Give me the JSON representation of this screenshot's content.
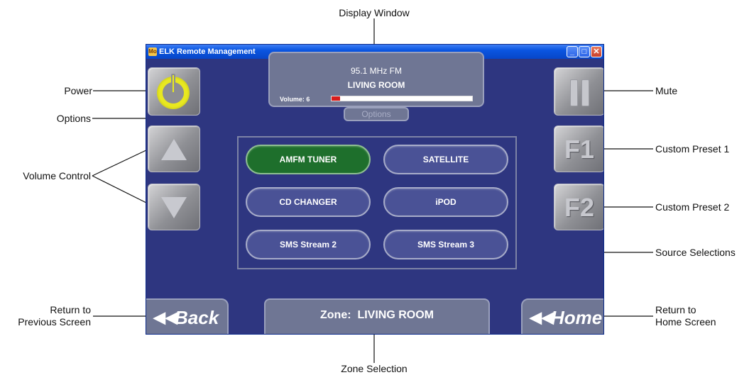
{
  "window": {
    "title": "ELK Remote Management",
    "app_icon": "Mo"
  },
  "display": {
    "frequency": "95.1 MHz FM",
    "room": "LIVING ROOM",
    "volume_label": "Volume: 6",
    "volume_fraction": 0.06
  },
  "options_label": "Options",
  "sources": [
    "AMFM TUNER",
    "SATELLITE",
    "CD CHANGER",
    "iPOD",
    "SMS Stream 2",
    "SMS Stream 3"
  ],
  "active_source": "AMFM TUNER",
  "presets": {
    "f1": "F1",
    "f2": "F2"
  },
  "nav": {
    "back": "Back",
    "home": "Home"
  },
  "zone_label": "Zone:  LIVING ROOM",
  "callouts": {
    "display_window": "Display Window",
    "power": "Power",
    "options": "Options",
    "volume_control": "Volume Control",
    "mute": "Mute",
    "custom_preset_1": "Custom Preset 1",
    "custom_preset_2": "Custom Preset 2",
    "source_selections": "Source Selections",
    "return_previous_1": "Return to",
    "return_previous_2": "Previous Screen",
    "return_home_1": "Return to",
    "return_home_2": "Home Screen",
    "zone_selection": "Zone Selection"
  },
  "colors": {
    "background": "#2e3680",
    "active_source": "#1e6f2c",
    "volume_fill": "#d81c1c",
    "power_icon": "#e8e820"
  }
}
